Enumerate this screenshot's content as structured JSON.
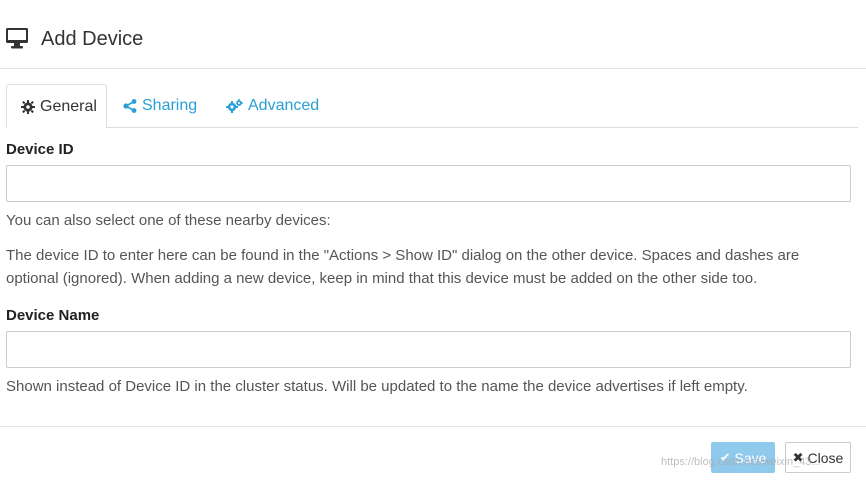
{
  "header": {
    "title": "Add Device",
    "icon": "desktop-monitor-icon"
  },
  "tabs": [
    {
      "label": "General",
      "icon": "gear-icon",
      "active": true
    },
    {
      "label": "Sharing",
      "icon": "share-icon",
      "active": false
    },
    {
      "label": "Advanced",
      "icon": "cogs-icon",
      "active": false
    }
  ],
  "form": {
    "device_id": {
      "label": "Device ID",
      "value": "",
      "nearby_hint": "You can also select one of these nearby devices:",
      "help": "The device ID to enter here can be found in the \"Actions > Show ID\" dialog on the other device. Spaces and dashes are optional (ignored). When adding a new device, keep in mind that this device must be added on the other side too."
    },
    "device_name": {
      "label": "Device Name",
      "value": "",
      "help": "Shown instead of Device ID in the cluster status. Will be updated to the name the device advertises if left empty."
    }
  },
  "footer": {
    "save_label": "Save",
    "close_label": "Close"
  },
  "watermark": "https://blog.csdn.net/weixin_43...",
  "colors": {
    "link": "#2a9fd6",
    "save_button": "#8fc9ec"
  }
}
